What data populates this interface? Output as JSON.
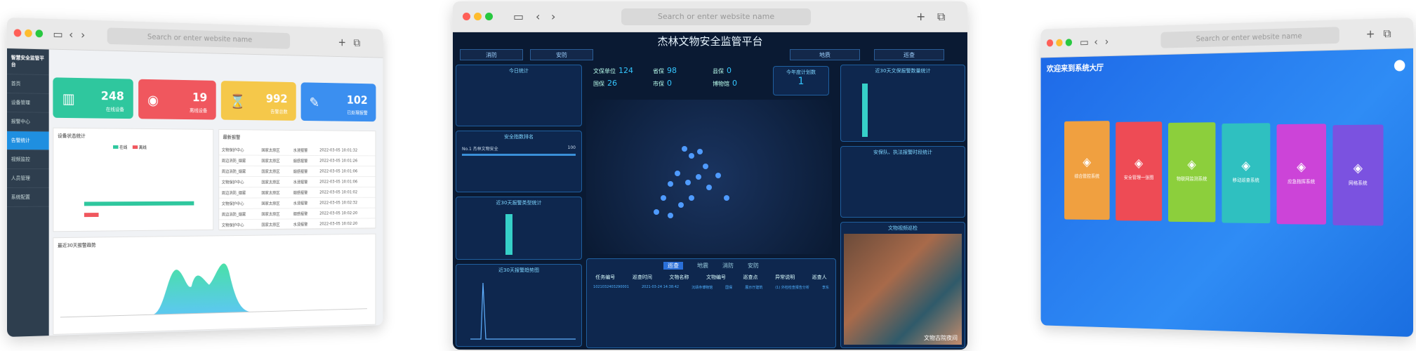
{
  "browser": {
    "address_placeholder": "Search or enter website name"
  },
  "left": {
    "app_title": "智慧安全监管平台",
    "sidebar": [
      "首页",
      "设备管理",
      "报警中心",
      "告警统计",
      "视频监控",
      "人员管理",
      "系统配置"
    ],
    "cards": [
      {
        "value": "248",
        "label": "在线设备",
        "color": "#2fc79e"
      },
      {
        "value": "19",
        "label": "离线设备",
        "color": "#f0575e"
      },
      {
        "value": "992",
        "label": "告警总数",
        "color": "#f5c84a"
      },
      {
        "value": "102",
        "label": "已处理报警",
        "color": "#3b8ff0"
      }
    ],
    "chart1": {
      "title": "设备状态统计",
      "legend": [
        "在线",
        "离线"
      ]
    },
    "alarm_panel": {
      "title": "最新报警",
      "rows": [
        [
          "文物保护中心",
          "国家太原区",
          "水浸报警",
          "2022-03-05 10:01:32"
        ],
        [
          "周边消防_烟雾",
          "国家太原区",
          "烟感报警",
          "2022-03-05 10:01:26"
        ],
        [
          "周边消防_烟雾",
          "国家太原区",
          "烟感报警",
          "2022-03-05 10:01:06"
        ],
        [
          "文物保护中心",
          "国家太原区",
          "水浸报警",
          "2022-03-05 10:01:06"
        ],
        [
          "周边消防_烟雾",
          "国家太原区",
          "烟感报警",
          "2022-03-05 10:01:02"
        ],
        [
          "文物保护中心",
          "国家太原区",
          "水浸报警",
          "2022-03-05 10:02:32"
        ],
        [
          "周边消防_烟雾",
          "国家太原区",
          "烟感报警",
          "2022-03-05 10:02:20"
        ],
        [
          "文物保护中心",
          "国家太原区",
          "水浸报警",
          "2022-03-05 10:02:20"
        ]
      ]
    },
    "area_title": "最近30天报警趋势"
  },
  "middle": {
    "title": "杰林文物安全监管平台",
    "nav": [
      "消防",
      "安防",
      "",
      "地质",
      "巡查"
    ],
    "stats": [
      {
        "label": "文保单位",
        "value": "124"
      },
      {
        "label": "国保",
        "value": "26"
      },
      {
        "label": "省保",
        "value": "98"
      },
      {
        "label": "市保",
        "value": "0"
      },
      {
        "label": "县保",
        "value": "0"
      },
      {
        "label": "博物馆",
        "value": "0"
      }
    ],
    "year_plan": {
      "label": "今年度计划数",
      "value": "1"
    },
    "panels": {
      "today": "今日统计",
      "rank": "安全指数排名",
      "rank_item": "No.1  杰林文物安全",
      "rank_value": "100",
      "alarm_type": "近30天报警类型统计",
      "trend": "近30天报警趋势图",
      "right1": "近30天文保报警数量统计",
      "right2": "安保队、执法报警时段统计",
      "video": "文物视频巡检",
      "video_caption": "文物古院夜间"
    },
    "tabs": [
      "巡查",
      "地震",
      "消防",
      "安防"
    ],
    "table_headers": [
      "任务编号",
      "巡查时间",
      "文物名称",
      "文物编号",
      "巡查点",
      "异常说明",
      "巡查人"
    ],
    "table_row": [
      "1021032403290001",
      "2021-03-24 14:38:42",
      "沉靖寺博物馆",
      "国保",
      "展示厅建筑",
      "(1) 外检检查报告分析",
      "李东"
    ]
  },
  "right": {
    "welcome": "欢迎来到系统大厅",
    "tiles": [
      {
        "label": "综合管控系统",
        "color": "#f0a040"
      },
      {
        "label": "安全管理一张图",
        "color": "#ee4b55"
      },
      {
        "label": "物联网监测系统",
        "color": "#8ccf3c"
      },
      {
        "label": "移动巡查系统",
        "color": "#2fc0c0"
      },
      {
        "label": "应急指挥系统",
        "color": "#cc44d8"
      },
      {
        "label": "网格系统",
        "color": "#7b52e0"
      }
    ]
  }
}
